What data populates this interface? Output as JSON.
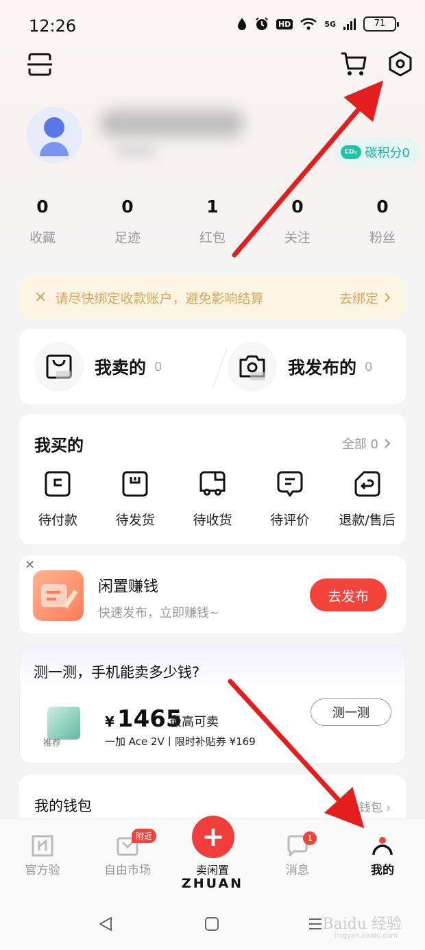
{
  "status_bar": {
    "time": "12:26",
    "hd": "HD",
    "network": "5G",
    "battery": "71"
  },
  "profile": {
    "carbon_points": "碳积分0",
    "co2_label": "CO₂"
  },
  "stats": [
    {
      "num": "0",
      "label": "收藏"
    },
    {
      "num": "0",
      "label": "足迹"
    },
    {
      "num": "1",
      "label": "红包"
    },
    {
      "num": "0",
      "label": "关注"
    },
    {
      "num": "0",
      "label": "粉丝"
    }
  ],
  "notice": {
    "close": "✕",
    "message": "请尽快绑定收款账户，避免影响结算",
    "action": "去绑定"
  },
  "sell_section": {
    "my_sold": {
      "label": "我卖的",
      "count": "0"
    },
    "my_published": {
      "label": "我发布的",
      "count": "0"
    }
  },
  "buy_section": {
    "title": "我买的",
    "all_label": "全部 0",
    "items": [
      {
        "label": "待付款"
      },
      {
        "label": "待发货"
      },
      {
        "label": "待收货"
      },
      {
        "label": "待评价"
      },
      {
        "label": "退款/售后"
      }
    ]
  },
  "earn": {
    "title": "闲置赚钱",
    "subtitle": "快速发布，立即赚钱~",
    "button": "去发布"
  },
  "test_phone": {
    "title": "测一测，手机能卖多少钱?",
    "currency": "¥",
    "price": "1465",
    "price_tag": "最高可卖",
    "model": "一加 Ace 2V丨限时补贴券 ¥169",
    "recommend": "推荐",
    "button": "测一测"
  },
  "wallet": {
    "title": "我的钱包",
    "link": "进入钱包"
  },
  "tabbar": {
    "tabs": [
      {
        "label": "官方验"
      },
      {
        "label": "自由市场",
        "badge": "附近"
      },
      {
        "label": "卖闲置"
      },
      {
        "label": "消息",
        "badge": "1"
      },
      {
        "label": "我的"
      }
    ],
    "brand": "ZHUAN"
  },
  "watermark": {
    "main": "Baidu 经验",
    "sub": "jingyan.baidu.com"
  },
  "colors": {
    "accent_red": "#f4433b",
    "carbon_green": "#1bb39a",
    "notice_text": "#d8a65a"
  }
}
